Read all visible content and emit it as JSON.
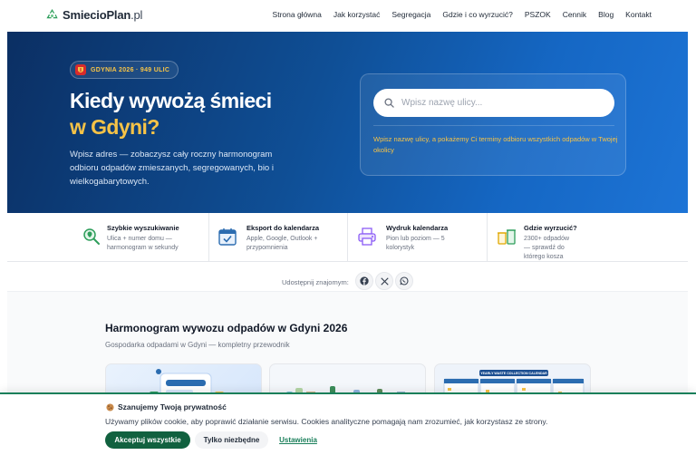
{
  "header": {
    "logo_name": "SmiecioPlan",
    "logo_tld": ".pl",
    "nav": [
      "Strona główna",
      "Jak korzystać",
      "Segregacja",
      "Gdzie i co wyrzucić?",
      "PSZOK",
      "Cennik",
      "Blog",
      "Kontakt"
    ]
  },
  "hero": {
    "badge": "GDYNIA 2026 · 949 ULIC",
    "title_line1": "Kiedy wywożą śmieci",
    "title_line2": "w Gdyni?",
    "description": "Wpisz adres — zobaczysz cały roczny harmonogram odbioru odpadów zmieszanych, segregowanych, bio i wielkogabarytowych.",
    "search_placeholder": "Wpisz nazwę ulicy...",
    "search_hint": "Wpisz nazwę ulicy, a pokażemy Ci terminy odbioru wszystkich odpadów w Twojej okolicy",
    "colors": {
      "accent": "#f6c347",
      "hero_dark": "#0b2f63",
      "hero_light": "#1d74d6"
    }
  },
  "features": [
    {
      "title": "Szybkie wyszukiwanie",
      "desc1": "Ulica + numer domu —",
      "desc2": "harmonogram w sekundy",
      "icon": "search-pin-icon"
    },
    {
      "title": "Eksport do kalendarza",
      "desc1": "Apple, Google, Outlook +",
      "desc2": "przypomnienia",
      "icon": "calendar-icon"
    },
    {
      "title": "Wydruk kalendarza",
      "desc1": "Pion lub poziom — 5 kolorystyk",
      "desc2": "",
      "icon": "printer-icon"
    },
    {
      "title": "Gdzie wyrzucić?",
      "desc1": "2300+ odpadów — sprawdź do",
      "desc2": "którego kosza",
      "icon": "bins-icon"
    }
  ],
  "share": {
    "label": "Udostępnij znajomym:",
    "icons": [
      "facebook-icon",
      "x-icon",
      "whatsapp-icon"
    ]
  },
  "section": {
    "title": "Harmonogram wywozu odpadów w Gdyni 2026",
    "subtitle": "Gospodarka odpadami w Gdyni — kompletny przewodnik",
    "card3_banner": "YEARLY WASTE COLLECTION CALENDAR"
  },
  "cookie": {
    "title": "Szanujemy Twoją prywatność",
    "text": "Używamy plików cookie, aby poprawić działanie serwisu. Cookies analityczne pomagają nam zrozumieć, jak korzystasz ze strony.",
    "accept_label": "Akceptuj wszystkie",
    "necessary_label": "Tylko niezbędne",
    "settings_label": "Ustawienia",
    "accent": "#11613f"
  }
}
